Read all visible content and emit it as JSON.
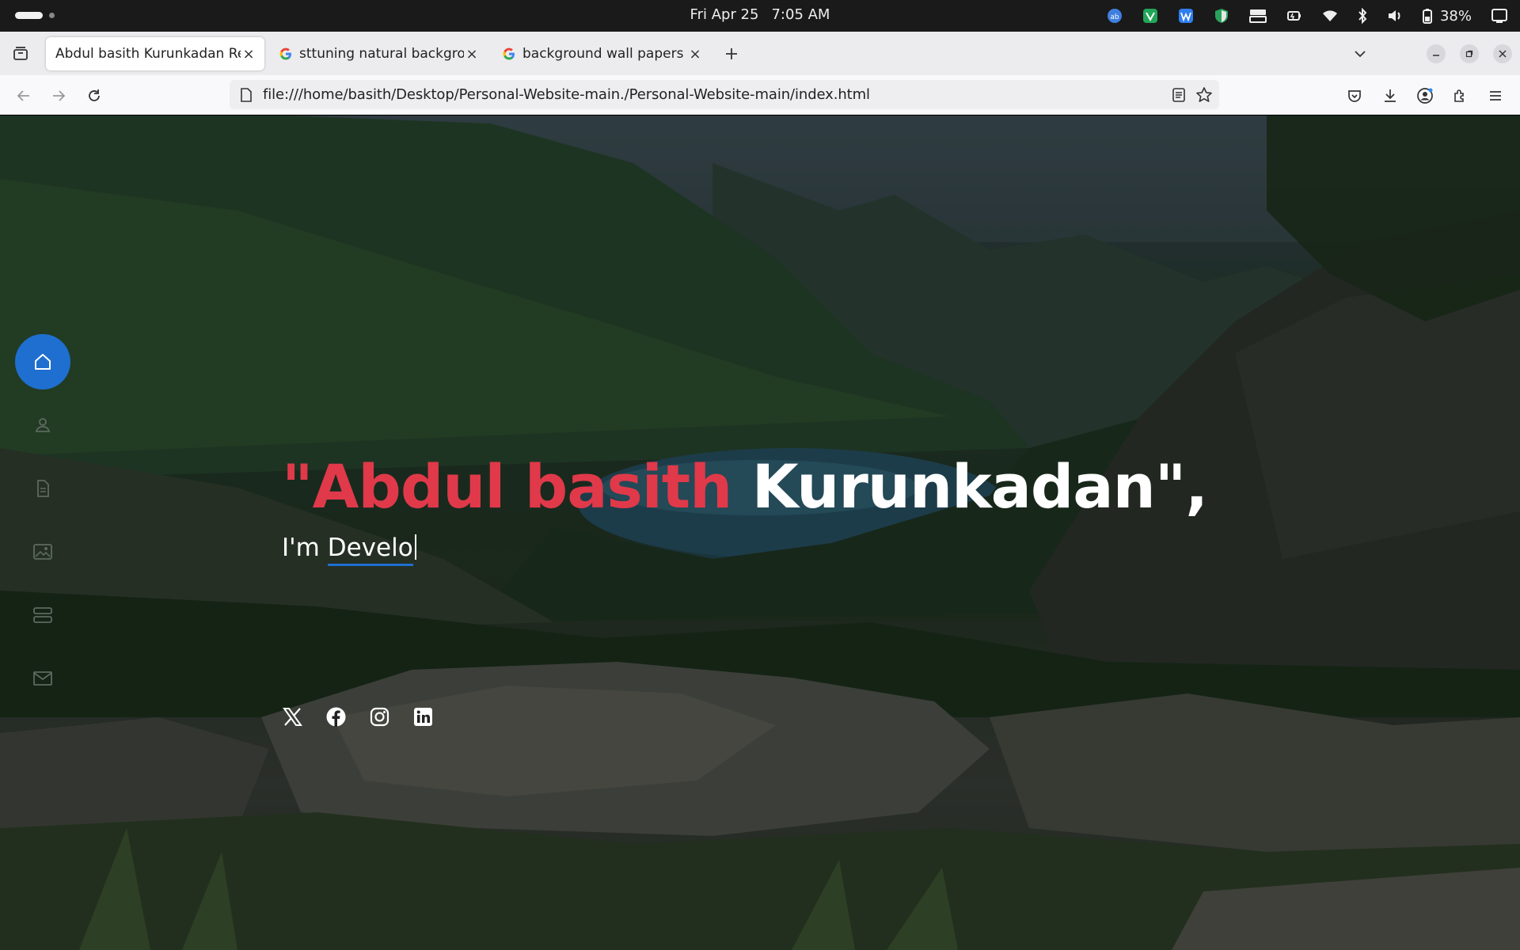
{
  "system": {
    "date": "Fri Apr 25",
    "time": "7:05 AM",
    "battery_pct": "38%"
  },
  "browser": {
    "tabs": [
      {
        "title": "Abdul basith Kurunkadan Res",
        "active": true,
        "icon": "page"
      },
      {
        "title": "sttuning natural backgrou",
        "active": false,
        "icon": "google-icon"
      },
      {
        "title": "background wall papers -",
        "active": false,
        "icon": "google-icon"
      }
    ],
    "url": "file:///home/basith/Desktop/Personal-Website-main./Personal-Website-main/index.html"
  },
  "page": {
    "headline_red": "\"Abdul basith",
    "headline_white": "Kurunkadan\",",
    "typed_prefix": "I'm",
    "typed_text": "Develo",
    "nav_items": [
      "home-icon",
      "person-icon",
      "document-icon",
      "images-icon",
      "server-icon",
      "envelope-icon"
    ],
    "socials": [
      "x-icon",
      "facebook-icon",
      "instagram-icon",
      "linkedin-icon"
    ],
    "colors": {
      "accent": "#1e6fcf",
      "name_red": "#e0394a"
    }
  }
}
